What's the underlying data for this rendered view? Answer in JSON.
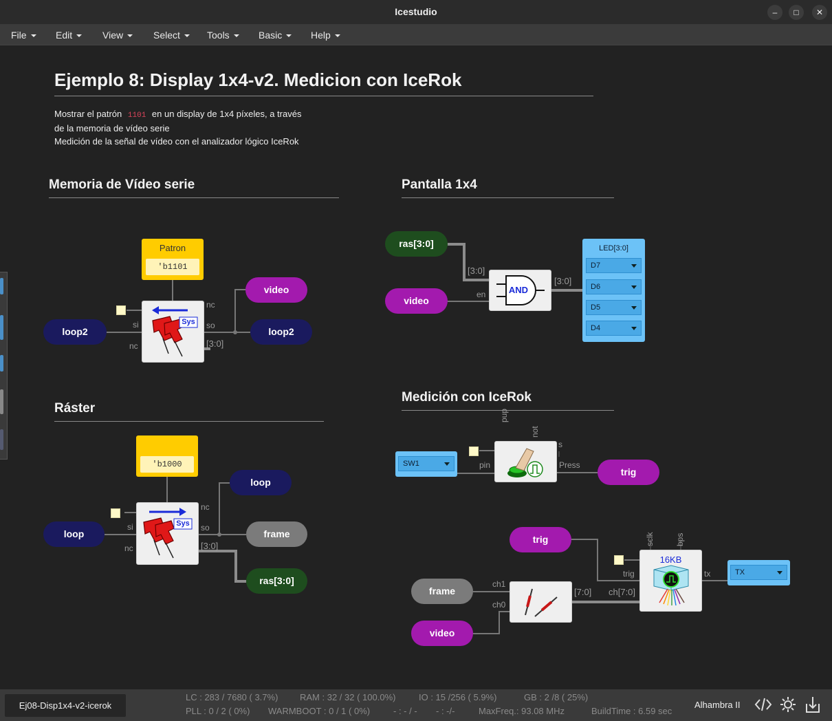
{
  "window": {
    "title": "Icestudio",
    "controls": {
      "minimize": "–",
      "maximize": "□",
      "close": "✕"
    }
  },
  "menu": [
    {
      "label": "File"
    },
    {
      "label": "Edit"
    },
    {
      "label": "View"
    },
    {
      "label": "Select"
    },
    {
      "label": "Tools"
    },
    {
      "label": "Basic"
    },
    {
      "label": "Help"
    }
  ],
  "canvas": {
    "title": "Ejemplo 8: Display 1x4-v2. Medicion con IceRok",
    "description": {
      "line1_before": "Mostrar el patrón",
      "line1_code": "1101",
      "line1_after": "en un display de 1x4 píxeles, a través",
      "line2": "de la memoria de vídeo serie",
      "line3": "Medición de la señal de vídeo con el analizador lógico IceRok"
    },
    "sections": {
      "memoria": {
        "heading": "Memoria de Vídeo serie",
        "constant": {
          "label": "Patron",
          "value": "'b1101"
        },
        "inputs": {
          "loop": "loop2"
        },
        "outputs": {
          "video": "video",
          "loop": "loop2"
        },
        "ports": {
          "si": "si",
          "nc_in": "nc",
          "nc_top": "nc",
          "so": "so",
          "bus": "[3:0]"
        },
        "sys_badge": "Sys",
        "arrow": "left"
      },
      "raster": {
        "heading": "Ráster",
        "constant": {
          "value": "'b1000"
        },
        "inputs": {
          "loop": "loop"
        },
        "outputs": {
          "loop": "loop",
          "frame": "frame",
          "ras": "ras[3:0]"
        },
        "ports": {
          "si": "si",
          "nc_in": "nc",
          "nc_top": "nc",
          "so": "so",
          "bus": "[3:0]"
        },
        "sys_badge": "Sys",
        "arrow": "right"
      },
      "pantalla": {
        "heading": "Pantalla 1x4",
        "inputs": {
          "ras": "ras[3:0]",
          "video": "video"
        },
        "gate": "AND",
        "ports": {
          "bus_in": "[3:0]",
          "en": "en",
          "bus_out": "[3:0]"
        },
        "led": {
          "title": "LED[3:0]",
          "pins": [
            "D7",
            "D6",
            "D5",
            "D4"
          ]
        }
      },
      "medicion": {
        "heading": "Medición con IceRok",
        "button_input": {
          "pin": "SW1"
        },
        "button_ports": {
          "pup": "pup",
          "not": "not",
          "s": "s",
          "pin": "pin",
          "press": "Press"
        },
        "trig_out": "trig",
        "trig_in": "trig",
        "frame_in": "frame",
        "video_in": "video",
        "probe_ports": {
          "ch1": "ch1",
          "ch0": "ch0",
          "bus": "[7:0]"
        },
        "analyzer": {
          "label": "16KB",
          "ports": {
            "sclk": "sclk",
            "bps": "bps",
            "trig": "trig",
            "ch": "ch[7:0]",
            "tx": "tx"
          }
        },
        "tx_pin": "TX"
      }
    }
  },
  "status": {
    "file": "Ej08-Disp1x4-v2-icerok",
    "row1": {
      "lc": "LC : 283 / 7680 ( 3.7%)",
      "ram": "RAM : 32 / 32 ( 100.0%)",
      "io": "IO : 15 /256 ( 5.9%)",
      "gb": "GB : 2 /8 ( 25%)"
    },
    "row2": {
      "pll": "PLL : 0 / 2 ( 0%)",
      "warmboot": "WARMBOOT : 0 / 1 ( 0%)",
      "blank1": "- : - / -",
      "blank2": "- : -/-",
      "maxfreq": "MaxFreq.: 93.08 MHz",
      "buildtime": "BuildTime : 6.59 sec"
    },
    "board": "Alhambra II"
  },
  "colors": {
    "background": "#222222",
    "navy": "#1a1a5e",
    "purple": "#a31aae",
    "green": "#1e4d1e",
    "gray": "#7b7b7b",
    "constant": "#ffcc00",
    "pin_blue": "#6cc2f7"
  },
  "icons": {
    "code": "code-icon",
    "settings": "settings-gear-icon",
    "upload": "upload-icon"
  }
}
